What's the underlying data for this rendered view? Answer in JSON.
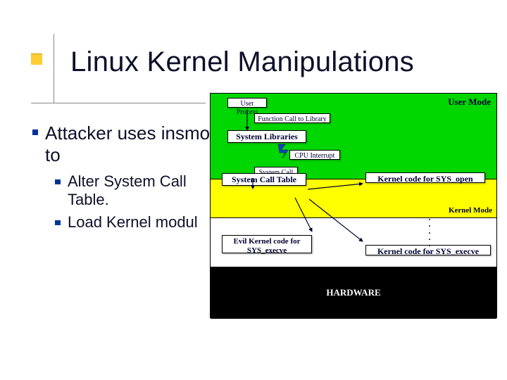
{
  "title": "Linux Kernel Manipulations",
  "bullets": {
    "main": "Attacker uses insmod to",
    "subs": [
      "Alter System Call Table.",
      "Load Kernel modul"
    ]
  },
  "diagram": {
    "zone_labels": {
      "user_mode": "User Mode",
      "kernel_mode": "Kernel Mode",
      "hardware": "HARDWARE"
    },
    "green": {
      "user_process": "User Process",
      "func_call": "Function Call to Library",
      "sys_libs": "System Libraries",
      "cpu_int": "CPU Interrupt",
      "sys_call": "System Call"
    },
    "yellow": {
      "sctable": "System Call Table",
      "kopen": "Kernel code for SYS_open"
    },
    "white": {
      "evil_execve": "Evil Kernel code for SYS_execve",
      "kexecve": "Kernel code for SYS_execve"
    }
  }
}
